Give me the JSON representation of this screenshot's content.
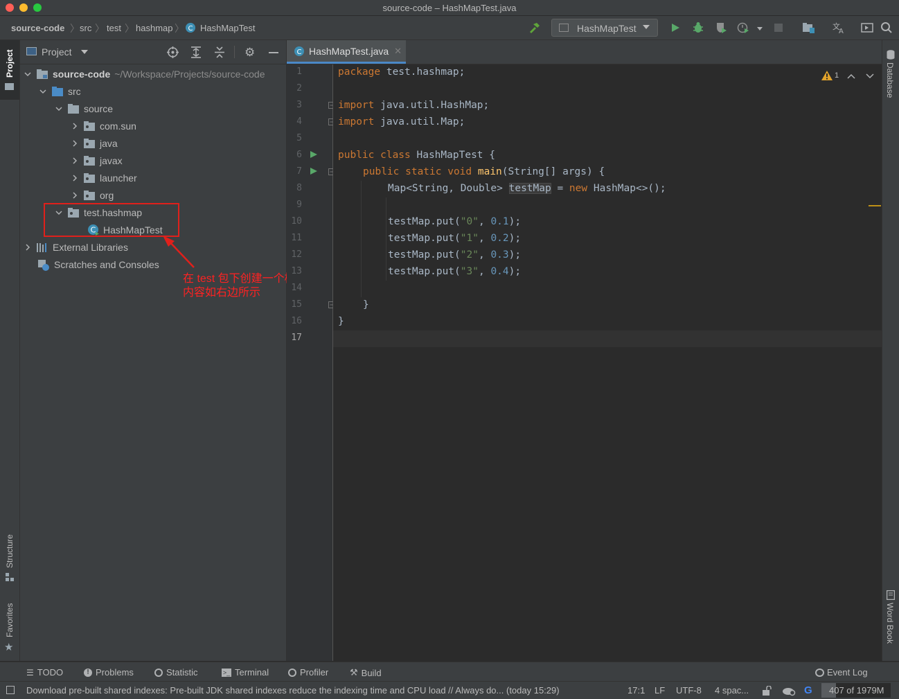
{
  "window": {
    "title": "source-code – HashMapTest.java",
    "traffic_colors": [
      "#ff5f57",
      "#febc2e",
      "#28c840"
    ]
  },
  "breadcrumbs": [
    "source-code",
    "src",
    "test",
    "hashmap",
    "HashMapTest"
  ],
  "run_config": {
    "label": "HashMapTest"
  },
  "left_tabs": {
    "project": "Project",
    "structure": "Structure",
    "favorites": "Favorites"
  },
  "right_tabs": {
    "database": "Database",
    "wordbook": "Word Book"
  },
  "project_panel": {
    "title": "Project",
    "root_name": "source-code",
    "root_path": "~/Workspace/Projects/source-code",
    "tree": {
      "src": "src",
      "source": "source",
      "com_sun": "com.sun",
      "java": "java",
      "javax": "javax",
      "launcher": "launcher",
      "org": "org",
      "test_hashmap": "test.hashmap",
      "hashmaptest": "HashMapTest",
      "external_libraries": "External Libraries",
      "scratches": "Scratches and Consoles"
    }
  },
  "annotation": {
    "line1": "在 test 包下创建一个样例",
    "line2": "内容如右边所示",
    "color": "#e0201b"
  },
  "editor": {
    "tab_label": "HashMapTest.java",
    "warning_count": "1",
    "line_numbers": [
      "1",
      "2",
      "3",
      "4",
      "5",
      "6",
      "7",
      "8",
      "9",
      "10",
      "11",
      "12",
      "13",
      "14",
      "15",
      "16",
      "17"
    ],
    "code": {
      "l1_kw": "package",
      "l1_rest": " test.hashmap;",
      "l3_kw": "import",
      "l3_rest": " java.util.HashMap;",
      "l4_kw": "import",
      "l4_rest": " java.util.Map;",
      "l6_kw": "public class",
      "l6_rest": " HashMapTest {",
      "l7_kw": "public static void",
      "l7_fn": " main",
      "l7_rest": "(String[] args) {",
      "l8_a": "Map<String, Double> ",
      "l8_var": "testMap",
      "l8_b": " = ",
      "l8_kw": "new",
      "l8_c": " HashMap<>();",
      "put_prefix": "testMap.put(",
      "put_comma": ", ",
      "put_suffix": ");",
      "puts": [
        {
          "key": "\"0\"",
          "val": "0.1"
        },
        {
          "key": "\"1\"",
          "val": "0.2"
        },
        {
          "key": "\"2\"",
          "val": "0.3"
        },
        {
          "key": "\"3\"",
          "val": "0.4"
        }
      ],
      "l15": "}",
      "l16": "}"
    }
  },
  "bottom_tools": {
    "todo": "TODO",
    "problems": "Problems",
    "statistic": "Statistic",
    "terminal": "Terminal",
    "profiler": "Profiler",
    "build": "Build",
    "event_log": "Event Log"
  },
  "status": {
    "message": "Download pre-built shared indexes: Pre-built JDK shared indexes reduce the indexing time and CPU load // Always do... (today 15:29)",
    "position": "17:1",
    "line_sep": "LF",
    "encoding": "UTF-8",
    "indent": "4 spac...",
    "memory": "407 of 1979M"
  }
}
